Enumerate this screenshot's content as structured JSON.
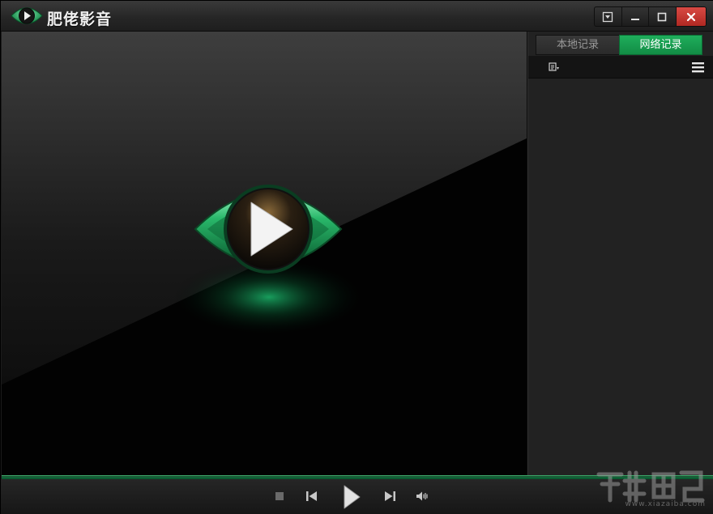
{
  "app": {
    "title": "肥佬影音"
  },
  "window_controls": [
    "dropdown-menu",
    "minimize",
    "maximize",
    "close"
  ],
  "side_panel": {
    "tabs": [
      {
        "label": "本地记录",
        "active": false
      },
      {
        "label": "网络记录",
        "active": true
      }
    ]
  },
  "player_controls": [
    "stop",
    "previous",
    "play",
    "next",
    "volume"
  ],
  "watermark": {
    "text": "www.xiazaiba.com"
  },
  "colors": {
    "accent": "#1fae5c",
    "close": "#c8332d",
    "background": "#020202"
  }
}
